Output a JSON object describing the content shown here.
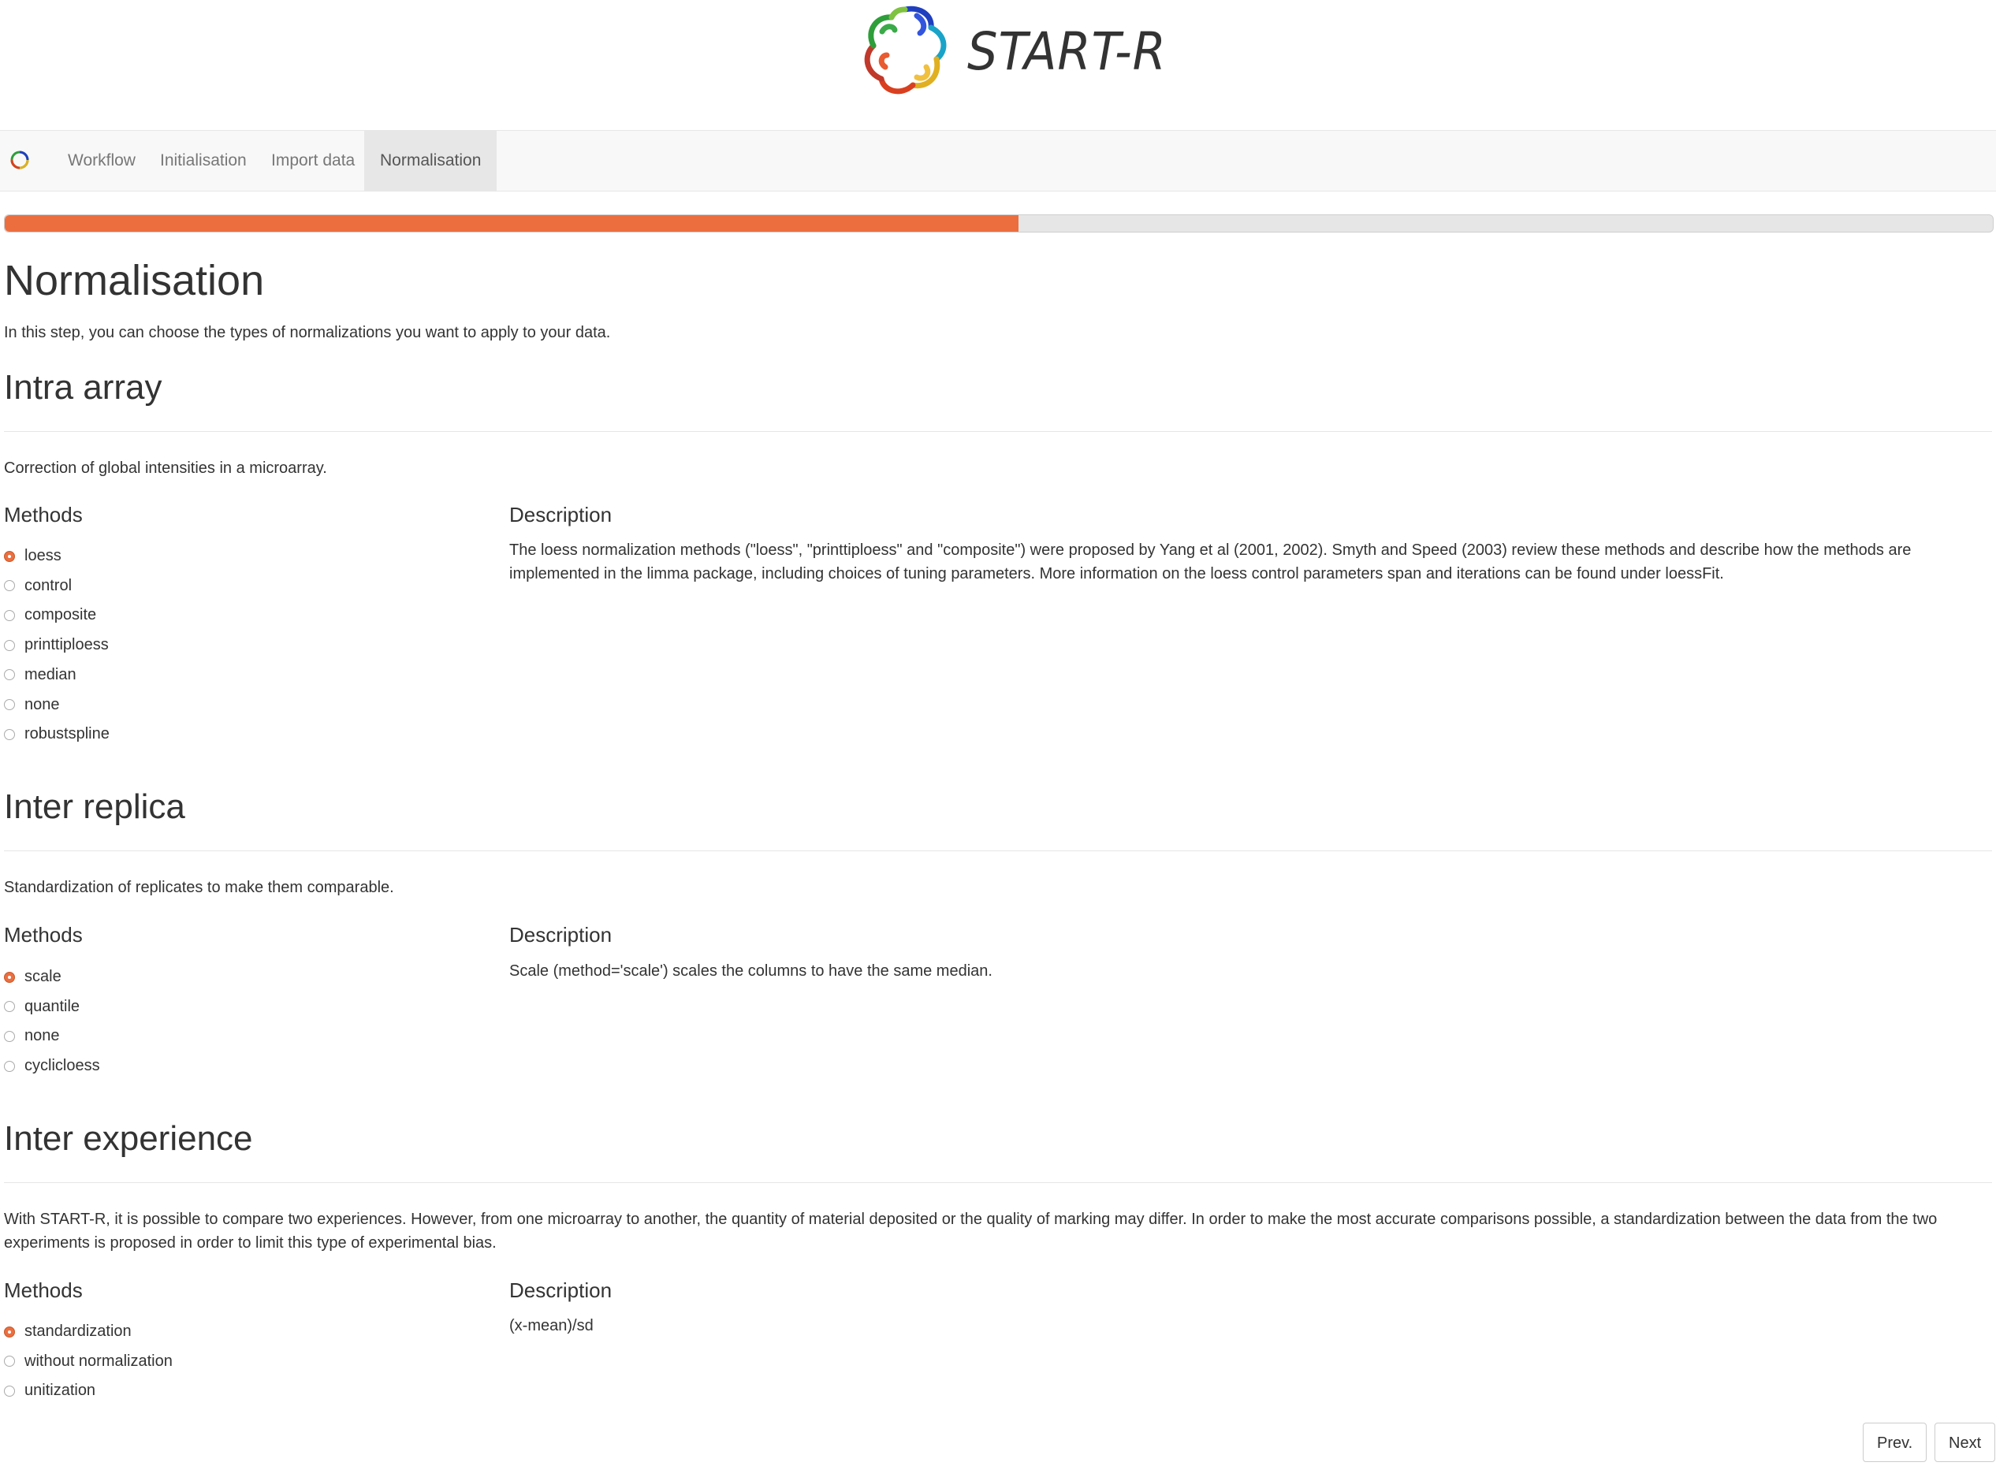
{
  "app": {
    "title": "START-R"
  },
  "navbar": {
    "items": [
      {
        "label": "Workflow",
        "active": false
      },
      {
        "label": "Initialisation",
        "active": false
      },
      {
        "label": "Import data",
        "active": false
      },
      {
        "label": "Normalisation",
        "active": true
      }
    ]
  },
  "progress": {
    "percent": 51
  },
  "page": {
    "title": "Normalisation",
    "subtitle": "In this step, you can choose the types of normalizations you want to apply to your data."
  },
  "sections": [
    {
      "title": "Intra array",
      "intro": "Correction of global intensities in a microarray.",
      "methods_label": "Methods",
      "description_label": "Description",
      "options": [
        "loess",
        "control",
        "composite",
        "printtiploess",
        "median",
        "none",
        "robustspline"
      ],
      "selected": "loess",
      "description": "The loess normalization methods (\"loess\", \"printtiploess\" and \"composite\") were proposed by Yang et al (2001, 2002). Smyth and Speed (2003) review these methods and describe how the methods are implemented in the limma package, including choices of tuning parameters. More information on the loess control parameters span and iterations can be found under loessFit."
    },
    {
      "title": "Inter replica",
      "intro": "Standardization of replicates to make them comparable.",
      "methods_label": "Methods",
      "description_label": "Description",
      "options": [
        "scale",
        "quantile",
        "none",
        "cyclicloess"
      ],
      "selected": "scale",
      "description": "Scale (method='scale') scales the columns to have the same median."
    },
    {
      "title": "Inter experience",
      "intro": "With START-R, it is possible to compare two experiences. However, from one microarray to another, the quantity of material deposited or the quality of marking may differ. In order to make the most accurate comparisons possible, a standardization between the data from the two experiments is proposed in order to limit this type of experimental bias.",
      "methods_label": "Methods",
      "description_label": "Description",
      "options": [
        "standardization",
        "without normalization",
        "unitization"
      ],
      "selected": "standardization",
      "description": "(x-mean)/sd"
    }
  ],
  "buttons": {
    "prev": "Prev.",
    "next": "Next"
  },
  "colors": {
    "accent": "#ec6e3f",
    "navbar_bg": "#f8f8f8",
    "nav_active_bg": "#e7e7e7"
  },
  "icons": {
    "logo": "protein-ring-logo",
    "brand": "protein-ring-small-logo"
  }
}
